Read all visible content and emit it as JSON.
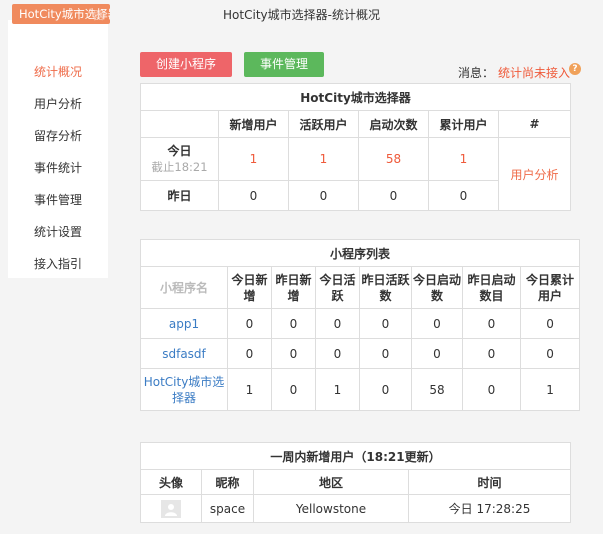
{
  "window_title": "HotCity城市选择器-统计概况",
  "sidebar": {
    "brand": "HotCity城市选择器",
    "items": [
      {
        "label": "统计概况",
        "active": true
      },
      {
        "label": "用户分析"
      },
      {
        "label": "留存分析"
      },
      {
        "label": "事件统计"
      },
      {
        "label": "事件管理"
      },
      {
        "label": "统计设置"
      },
      {
        "label": "接入指引"
      }
    ]
  },
  "toolbar": {
    "create_label": "创建小程序",
    "events_label": "事件管理",
    "msg_label": "消息：",
    "msg_link": "统计尚未接入",
    "help_icon": "?"
  },
  "stats": {
    "title": "HotCity城市选择器",
    "columns": [
      "",
      "新增用户",
      "活跃用户",
      "启动次数",
      "累计用户",
      "#"
    ],
    "today": {
      "label": "今日",
      "sub": "截止18:21",
      "values": [
        "1",
        "1",
        "58",
        "1"
      ]
    },
    "yesterday": {
      "label": "昨日",
      "values": [
        "0",
        "0",
        "0",
        "0"
      ]
    },
    "action": "用户分析"
  },
  "apps": {
    "title": "小程序列表",
    "columns": [
      "小程序名",
      "今日新增",
      "昨日新增",
      "今日活跃",
      "昨日活跃数",
      "今日启动数",
      "昨日启动数目",
      "今日累计用户"
    ],
    "rows": [
      {
        "name": "app1",
        "values": [
          "0",
          "0",
          "0",
          "0",
          "0",
          "0",
          "0"
        ]
      },
      {
        "name": "sdfasdf",
        "values": [
          "0",
          "0",
          "0",
          "0",
          "0",
          "0",
          "0"
        ]
      },
      {
        "name": "HotCity城市选择器",
        "values": [
          "1",
          "0",
          "1",
          "0",
          "58",
          "0",
          "1"
        ]
      }
    ]
  },
  "weekly": {
    "title": "一周内新增用户（18:21更新）",
    "columns": [
      "头像",
      "昵称",
      "地区",
      "时间"
    ],
    "rows": [
      {
        "avatar_icon": "avatar-placeholder-icon",
        "nickname": "space",
        "region": "Yellowstone",
        "time": "今日 17:28:25"
      }
    ]
  },
  "colors": {
    "accent": "#ef6c4a",
    "create_button": "#ee6569",
    "events_button": "#5cb85c",
    "link_blue": "#3b7cc4"
  }
}
